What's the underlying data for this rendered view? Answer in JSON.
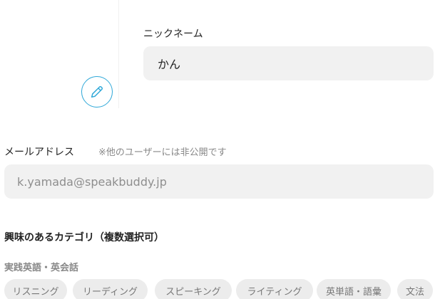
{
  "profile": {
    "nickname_label": "ニックネーム",
    "nickname_value": "かん",
    "edit_icon": "pencil-icon"
  },
  "email": {
    "label": "メールアドレス",
    "note": "※他のユーザーには非公開です",
    "value": "k.yamada@speakbuddy.jp"
  },
  "interests": {
    "heading": "興味のあるカテゴリ（複数選択可）",
    "category_label": "実践英語・英会話",
    "chips": [
      "リスニング",
      "リーディング",
      "スピーキング",
      "ライティング",
      "英単語・語彙",
      "文法"
    ]
  },
  "colors": {
    "accent": "#2fa8d8",
    "field_bg": "#f1f1f1",
    "chip_bg": "#ececec"
  }
}
